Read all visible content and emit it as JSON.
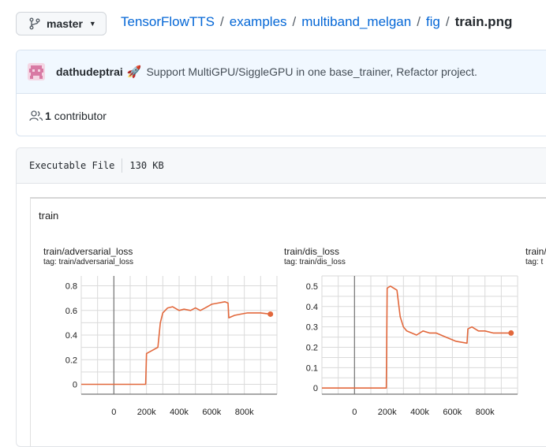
{
  "branch": {
    "name": "master"
  },
  "breadcrumb": {
    "repo": "TensorFlowTTS",
    "parts": [
      "examples",
      "multiband_melgan",
      "fig"
    ],
    "file": "train.png",
    "separator": "/"
  },
  "commit": {
    "author": "dathudeptrai",
    "emoji": "🚀",
    "message": "Support MultiGPU/SiggleGPU in one base_trainer, Refactor project."
  },
  "contributors": {
    "count": "1",
    "label": "contributor"
  },
  "file_info": {
    "mode": "Executable File",
    "size": "130 KB"
  },
  "image": {
    "title": "train"
  },
  "colors": {
    "line": "#e2683c",
    "grid": "#dadada",
    "link": "#0366d6"
  },
  "chart_data": [
    {
      "type": "line",
      "title": "train/adversarial_loss",
      "subtitle": "tag: train/adversarial_loss",
      "xticks": [
        "0",
        "200k",
        "400k",
        "600k",
        "800k"
      ],
      "yticks": [
        "0",
        "0.2",
        "0.4",
        "0.6",
        "0.8"
      ],
      "xlim": [
        -200000,
        1000000
      ],
      "ylim": [
        -0.08,
        0.88
      ],
      "x": [
        -200000,
        195000,
        200000,
        270000,
        285000,
        300000,
        330000,
        360000,
        400000,
        430000,
        470000,
        500000,
        530000,
        560000,
        600000,
        640000,
        680000,
        700000,
        705000,
        740000,
        780000,
        820000,
        860000,
        900000,
        960000
      ],
      "y": [
        0,
        0,
        0.25,
        0.3,
        0.5,
        0.58,
        0.62,
        0.63,
        0.6,
        0.61,
        0.6,
        0.62,
        0.6,
        0.62,
        0.65,
        0.66,
        0.67,
        0.66,
        0.54,
        0.56,
        0.57,
        0.58,
        0.58,
        0.58,
        0.57
      ]
    },
    {
      "type": "line",
      "title": "train/dis_loss",
      "subtitle": "tag: train/dis_loss",
      "xticks": [
        "0",
        "200k",
        "400k",
        "600k",
        "800k"
      ],
      "yticks": [
        "0",
        "0.1",
        "0.2",
        "0.3",
        "0.4",
        "0.5"
      ],
      "xlim": [
        -200000,
        1000000
      ],
      "ylim": [
        -0.03,
        0.55
      ],
      "x": [
        -200000,
        195000,
        200000,
        220000,
        260000,
        280000,
        300000,
        320000,
        350000,
        380000,
        420000,
        460000,
        500000,
        560000,
        620000,
        690000,
        695000,
        720000,
        760000,
        800000,
        850000,
        900000,
        960000
      ],
      "y": [
        0,
        0,
        0.49,
        0.5,
        0.48,
        0.35,
        0.3,
        0.28,
        0.27,
        0.26,
        0.28,
        0.27,
        0.27,
        0.25,
        0.23,
        0.22,
        0.29,
        0.3,
        0.28,
        0.28,
        0.27,
        0.27,
        0.27
      ]
    }
  ],
  "partial_panel": {
    "title": "train/",
    "subtitle": "tag: t"
  }
}
